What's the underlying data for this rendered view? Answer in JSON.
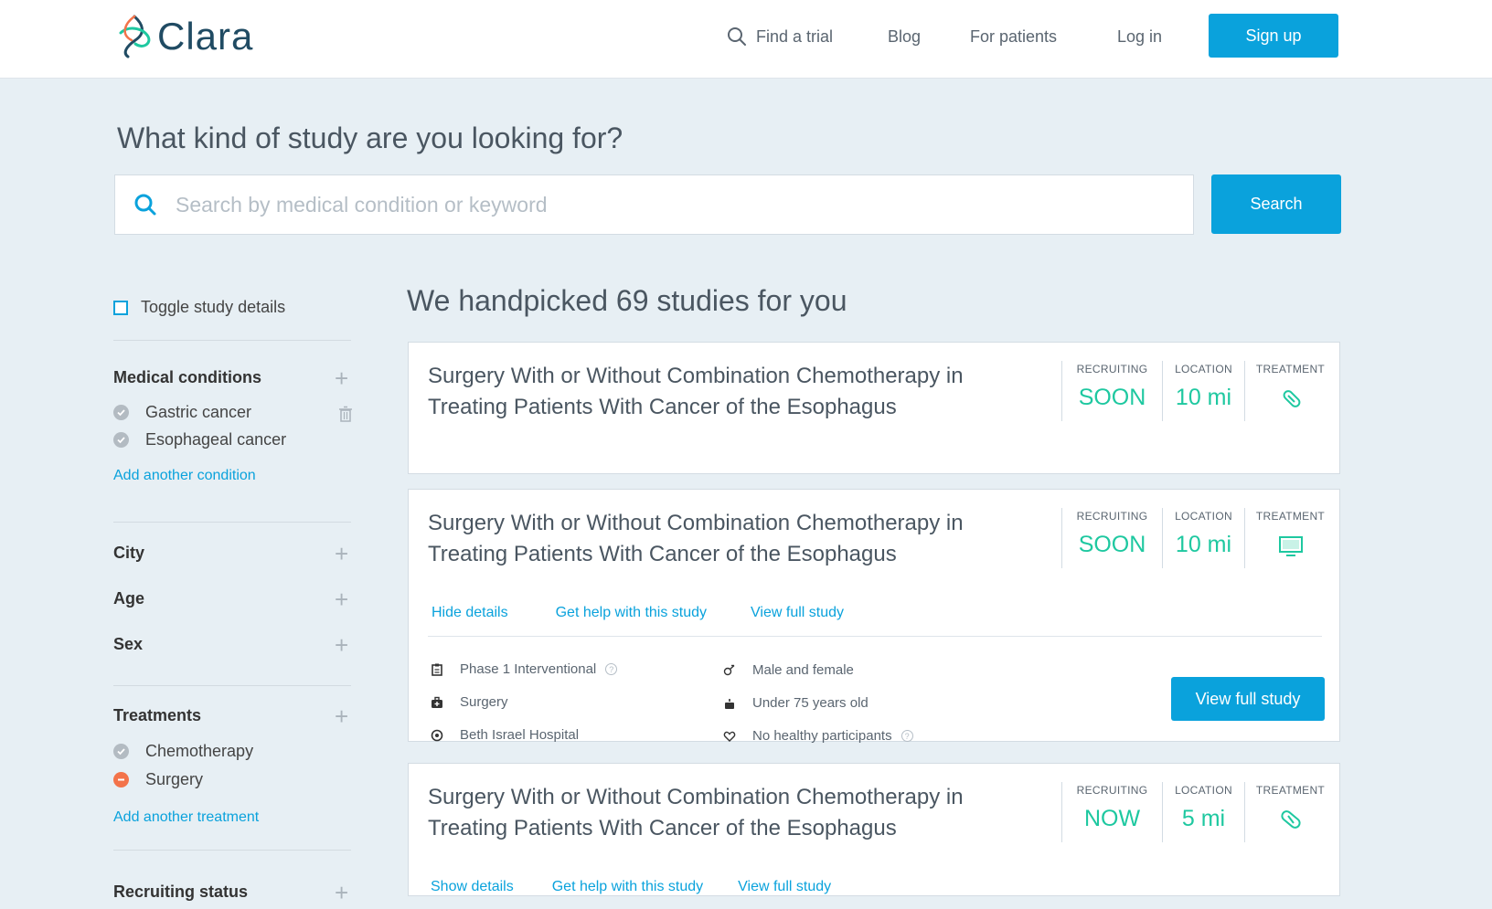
{
  "brand": {
    "name": "Clara"
  },
  "nav": {
    "find_trial": "Find a trial",
    "blog": "Blog",
    "for_patients": "For patients",
    "login": "Log in",
    "signup": "Sign up"
  },
  "search": {
    "question": "What kind of study are you looking for?",
    "placeholder": "Search by medical condition or keyword",
    "button": "Search"
  },
  "sidebar": {
    "toggle_label": "Toggle study details",
    "medical_conditions": {
      "title": "Medical conditions",
      "items": [
        "Gastric cancer",
        "Esophageal cancer"
      ],
      "add_label": "Add another condition"
    },
    "city": {
      "title": "City"
    },
    "age": {
      "title": "Age"
    },
    "sex": {
      "title": "Sex"
    },
    "treatments": {
      "title": "Treatments",
      "items": [
        "Chemotherapy",
        "Surgery"
      ],
      "add_label": "Add another treatment"
    },
    "recruiting_status": {
      "title": "Recruiting status"
    }
  },
  "results": {
    "title": "We handpicked 69 studies for you",
    "labels": {
      "recruiting": "RECRUITING",
      "location": "LOCATION",
      "treatment": "TREATMENT"
    },
    "cards": [
      {
        "title": "Surgery With or Without Combination Chemotherapy in Treating Patients With Cancer of the Esophagus",
        "recruiting": "SOON",
        "location": "10 mi",
        "treatment_icon": "pill-icon"
      },
      {
        "title": "Surgery With or Without Combination Chemotherapy in Treating Patients With Cancer of the Esophagus",
        "recruiting": "SOON",
        "location": "10 mi",
        "treatment_icon": "monitor-icon",
        "links": {
          "toggle": "Hide details",
          "help": "Get help with this study",
          "view": "View full study"
        },
        "details": {
          "phase": "Phase 1 Interventional",
          "type": "Surgery",
          "hospital": "Beth Israel Hospital",
          "sex": "Male and female",
          "age": "Under 75 years old",
          "healthy": "No healthy participants"
        },
        "button": "View full study"
      },
      {
        "title": "Surgery With or Without Combination Chemotherapy in Treating Patients With Cancer of the Esophagus",
        "recruiting": "NOW",
        "location": "5 mi",
        "treatment_icon": "capsule-icon",
        "links": {
          "toggle": "Show details",
          "help": "Get help with this study",
          "view": "View full study"
        }
      }
    ]
  },
  "colors": {
    "accent": "#0aa2dc",
    "stat": "#1ec8a0",
    "background": "#e7eff4",
    "removed": "#f3734a"
  }
}
